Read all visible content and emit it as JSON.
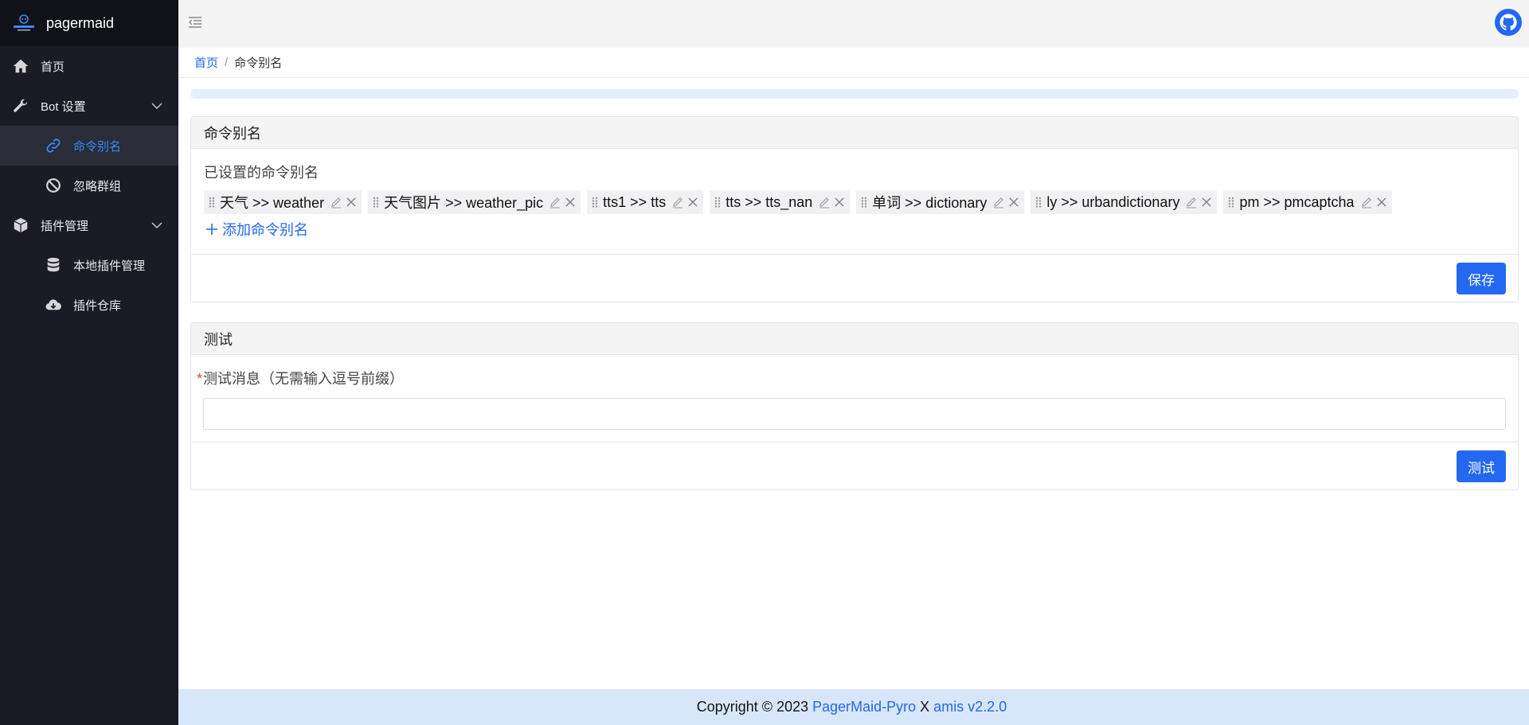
{
  "brand": {
    "name": "pagermaid"
  },
  "sidebar": {
    "items": [
      {
        "label": "首页",
        "icon": "home-icon"
      },
      {
        "label": "Bot 设置",
        "icon": "wrench-icon"
      },
      {
        "label": "命令别名",
        "icon": "link-icon",
        "active": true
      },
      {
        "label": "忽略群组",
        "icon": "ban-icon"
      },
      {
        "label": "插件管理",
        "icon": "cube-icon"
      },
      {
        "label": "本地插件管理",
        "icon": "database-icon"
      },
      {
        "label": "插件仓库",
        "icon": "cloud-download-icon"
      }
    ]
  },
  "breadcrumb": {
    "home": "首页",
    "separator": "/",
    "current": "命令别名"
  },
  "alias_panel": {
    "title": "命令别名",
    "field_label": "已设置的命令别名",
    "tags": [
      "天气 >> weather",
      "天气图片 >> weather_pic",
      "tts1 >> tts",
      "tts >> tts_nan",
      "单词 >> dictionary",
      "ly >> urbandictionary",
      "pm >> pmcaptcha"
    ],
    "add_label": "添加命令别名",
    "save_label": "保存"
  },
  "test_panel": {
    "title": "测试",
    "required_mark": "*",
    "field_label": "测试消息（无需输入逗号前缀）",
    "input_value": "",
    "submit_label": "测试"
  },
  "footer": {
    "prefix": "Copyright © 2023",
    "link1": "PagerMaid-Pyro",
    "middle": "X",
    "link2": "amis v2.2.0"
  },
  "colors": {
    "accent": "#2468f2",
    "sidebar_bg": "#1a1b24",
    "footer_bg": "#d7e6fb"
  }
}
